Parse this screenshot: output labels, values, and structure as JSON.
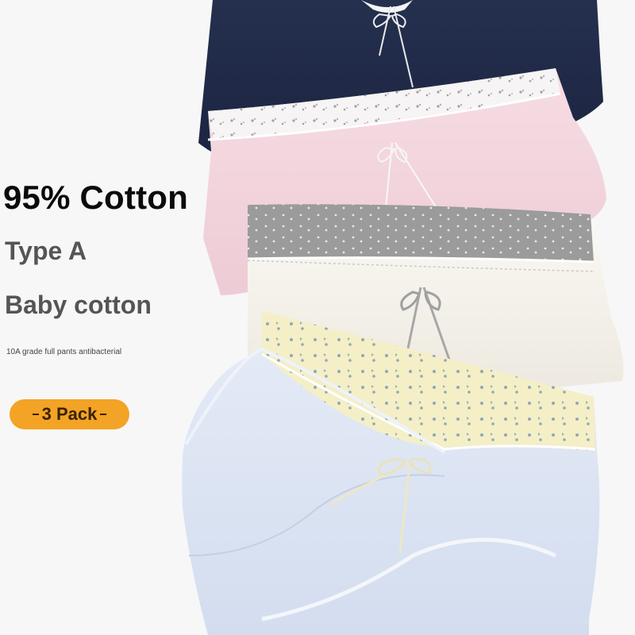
{
  "product": {
    "headline": "95% Cotton",
    "type_label": "Type A",
    "material_label": "Baby cotton",
    "tagline": "10A grade full pants antibacterial",
    "pack_label": "3 Pack"
  },
  "colors": {
    "navy": "#1f2946",
    "pink": "#f2d5dc",
    "grey_band": "#9d9d9d",
    "ivory": "#f5f2ea",
    "light_blue": "#dfe6f4",
    "yellow_band": "#f4efc6",
    "badge": "#f3a325"
  },
  "icons": [
    "bow-icon",
    "floral-print-pattern"
  ]
}
